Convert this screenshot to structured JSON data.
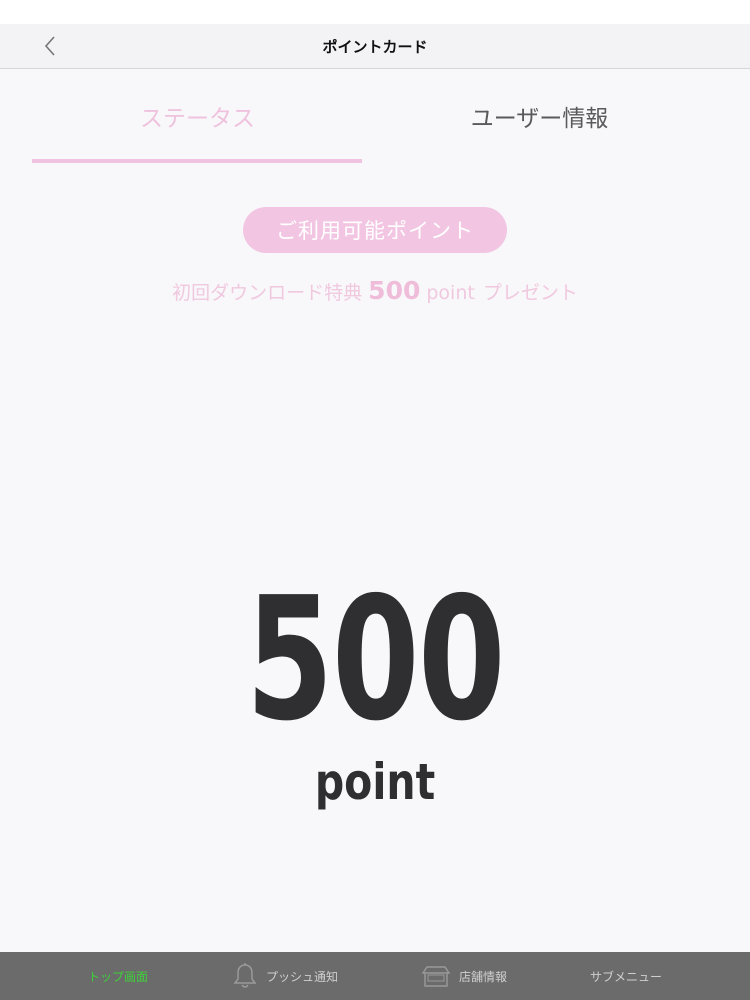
{
  "nav": {
    "title": "ポイントカード",
    "back_icon": "chevron-left-icon"
  },
  "tabs": {
    "status_label": "ステータス",
    "user_info_label": "ユーザー情報",
    "active": "status"
  },
  "points": {
    "pill_label": "ご利用可能ポイント",
    "bonus_prefix": "初回ダウンロード特典",
    "bonus_amount": "500",
    "bonus_unit": "point",
    "bonus_suffix": "プレゼント",
    "value": "500",
    "unit": "point"
  },
  "bottom_nav": {
    "items": [
      {
        "label": "トップ画面",
        "icon": "",
        "active": true
      },
      {
        "label": "プッシュ通知",
        "icon": "bell-icon",
        "active": false
      },
      {
        "label": "店舗情報",
        "icon": "shop-icon",
        "active": false
      },
      {
        "label": "サブメニュー",
        "icon": "",
        "active": false
      }
    ]
  },
  "colors": {
    "accent_pink": "#f2c6e2",
    "active_green": "#3ed13a",
    "bottom_bar": "#6b6b6b",
    "value_text": "#2f2f31"
  }
}
